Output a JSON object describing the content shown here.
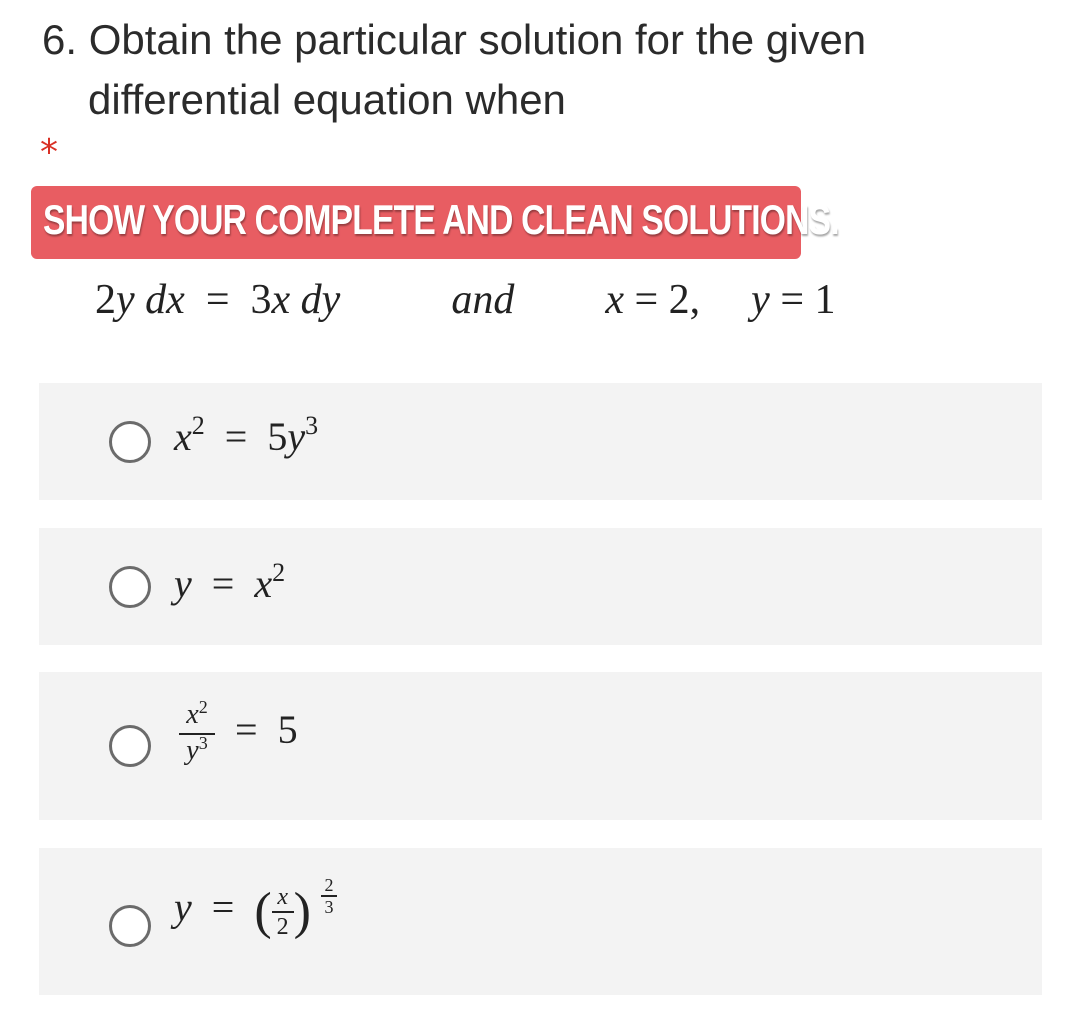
{
  "question": {
    "number": "6.",
    "title_line1": "Obtain the particular solution for the given",
    "title_line2": "differential equation when",
    "required_marker": "*",
    "banner_text": "SHOW YOUR COMPLETE AND CLEAN SOLUTIONS.",
    "banner_color": "#e85d62",
    "equation": {
      "lhs_coef": "2",
      "lhs_var": "y",
      "lhs_diff": "dx",
      "equals": "=",
      "rhs_coef": "3",
      "rhs_var": "x",
      "rhs_diff": "dy",
      "conjunction": "and",
      "cond_x_var": "x",
      "cond_x_val": "= 2,",
      "cond_y_var": "y",
      "cond_y_val": "= 1"
    }
  },
  "options": [
    {
      "text": "x^2 = 5y^3",
      "base1": "x",
      "exp1": "2",
      "eq": "=",
      "coef": "5",
      "base2": "y",
      "exp2": "3",
      "selected": false
    },
    {
      "text": "y = x^2",
      "base1": "y",
      "eq": "=",
      "base2": "x",
      "exp2": "2",
      "selected": false
    },
    {
      "text": "x^2 / y^3 = 5",
      "num_base": "x",
      "num_exp": "2",
      "den_base": "y",
      "den_exp": "3",
      "eq": "=",
      "rhs": "5",
      "selected": false
    },
    {
      "text": "y = (x/2)^(2/3)",
      "base1": "y",
      "eq": "=",
      "open": "(",
      "frac_num": "x",
      "frac_den": "2",
      "close": ")",
      "exp_num": "2",
      "exp_den": "3",
      "selected": false
    }
  ]
}
